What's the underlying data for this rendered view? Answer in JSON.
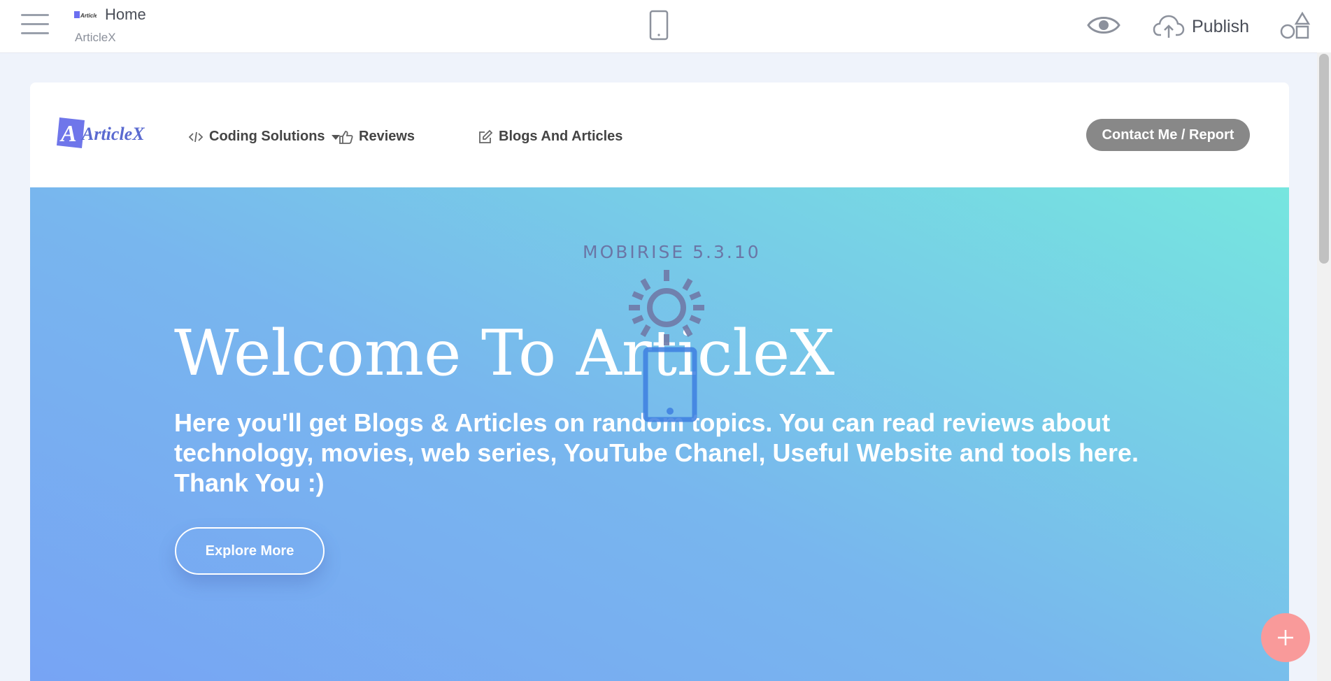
{
  "editor": {
    "page_title": "Home",
    "project_name": "ArticleX",
    "publish_label": "Publish",
    "mini_logo_text": "ArticleX"
  },
  "site": {
    "brand_text": "ArticleX",
    "nav": {
      "coding": "Coding Solutions",
      "reviews": "Reviews",
      "blogs": "Blogs And Articles"
    },
    "contact_label": "Contact Me / Report",
    "hero": {
      "version": "MOBIRISE 5.3.10",
      "title": "Welcome To ArticleX",
      "text": "Here you'll get Blogs & Articles on random topics. You can read reviews about technology, movies, web series, YouTube Chanel, Useful Website and tools here. Thank You :)",
      "button": "Explore More"
    }
  },
  "colors": {
    "hero_gradient_start": "#77a4f4",
    "hero_gradient_end": "#76e6df",
    "contact_button": "#888888",
    "fab": "#f99a9a"
  },
  "icons": [
    "hamburger-menu-icon",
    "mobile-device-icon",
    "eye-icon",
    "cloud-upload-icon",
    "blocks-icon",
    "code-icon",
    "caret-down-icon",
    "thumbs-up-icon",
    "edit-icon",
    "plus-icon",
    "loading-sun-icon",
    "loading-phone-icon"
  ]
}
